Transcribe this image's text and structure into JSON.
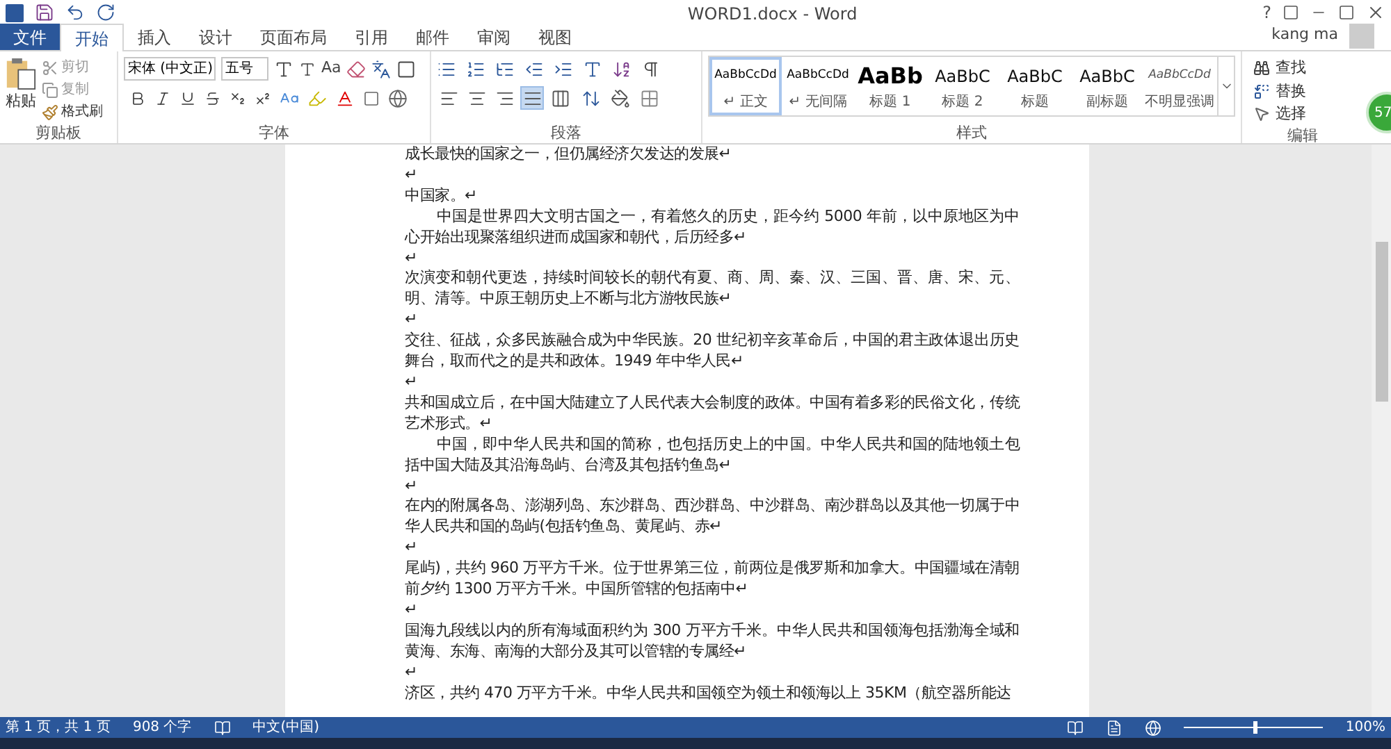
{
  "title_bar": {
    "title": "WORD1.docx - Word",
    "help": "?"
  },
  "tabs": [
    {
      "label": "文件",
      "kind": "file",
      "selected": false
    },
    {
      "label": "开始",
      "kind": "tab",
      "selected": true
    },
    {
      "label": "插入",
      "kind": "tab",
      "selected": false
    },
    {
      "label": "设计",
      "kind": "tab",
      "selected": false
    },
    {
      "label": "页面布局",
      "kind": "tab",
      "selected": false
    },
    {
      "label": "引用",
      "kind": "tab",
      "selected": false
    },
    {
      "label": "邮件",
      "kind": "tab",
      "selected": false
    },
    {
      "label": "审阅",
      "kind": "tab",
      "selected": false
    },
    {
      "label": "视图",
      "kind": "tab",
      "selected": false
    }
  ],
  "account": {
    "name": "kang ma"
  },
  "clipboard": {
    "paste": "粘贴",
    "cut": "剪切",
    "copy": "复制",
    "format_painter": "格式刷",
    "label": "剪贴板"
  },
  "font": {
    "name": "宋体 (中文正)",
    "size": "五号",
    "change_case": "Aa",
    "label": "字体"
  },
  "paragraph": {
    "label": "段落",
    "alignments": [
      {
        "kind": "left",
        "selected": false
      },
      {
        "kind": "center",
        "selected": false
      },
      {
        "kind": "right",
        "selected": false
      },
      {
        "kind": "justify",
        "selected": true
      },
      {
        "kind": "distributed",
        "selected": false
      }
    ]
  },
  "styles": {
    "label": "样式",
    "items": [
      {
        "kind": "normal",
        "preview": "AaBbCcDd",
        "name": "↵ 正文",
        "selected": true
      },
      {
        "kind": "normal",
        "preview": "AaBbCcDd",
        "name": "↵ 无间隔",
        "selected": false
      },
      {
        "kind": "heading1",
        "preview": "AaBb",
        "name": "标题 1",
        "selected": false
      },
      {
        "kind": "heading2",
        "preview": "AaBbC",
        "name": "标题 2",
        "selected": false
      },
      {
        "kind": "heading2",
        "preview": "AaBbC",
        "name": "标题",
        "selected": false
      },
      {
        "kind": "heading2",
        "preview": "AaBbC",
        "name": "副标题",
        "selected": false
      },
      {
        "kind": "emphasis",
        "preview": "AaBbCcDd",
        "name": "不明显强调",
        "selected": false
      }
    ]
  },
  "editing": {
    "find": "查找",
    "replace": "替换",
    "select": "选择",
    "label": "编辑"
  },
  "document": {
    "paragraphs": [
      {
        "text": "成长最快的国家之一，但仍属经济欠发达的发展↵",
        "indent": false
      },
      {
        "text": "↵",
        "indent": false
      },
      {
        "text": "中国家。↵",
        "indent": false
      },
      {
        "text": "中国是世界四大文明古国之一，有着悠久的历史，距今约 5000 年前，以中原地区为中心开始出现聚落组织进而成国家和朝代，后历经多↵",
        "indent": true
      },
      {
        "text": "↵",
        "indent": false
      },
      {
        "text": "次演变和朝代更迭，持续时间较长的朝代有夏、商、周、秦、汉、三国、晋、唐、宋、元、明、清等。中原王朝历史上不断与北方游牧民族↵",
        "indent": false
      },
      {
        "text": "↵",
        "indent": false
      },
      {
        "text": "交往、征战，众多民族融合成为中华民族。20 世纪初辛亥革命后，中国的君主政体退出历史舞台，取而代之的是共和政体。1949 年中华人民↵",
        "indent": false
      },
      {
        "text": "↵",
        "indent": false
      },
      {
        "text": "共和国成立后，在中国大陆建立了人民代表大会制度的政体。中国有着多彩的民俗文化，传统艺术形式。↵",
        "indent": false
      },
      {
        "text": "中国，即中华人民共和国的简称，也包括历史上的中国。中华人民共和国的陆地领土包括中国大陆及其沿海岛屿、台湾及其包括钓鱼岛↵",
        "indent": true
      },
      {
        "text": "↵",
        "indent": false
      },
      {
        "text": "在内的附属各岛、澎湖列岛、东沙群岛、西沙群岛、中沙群岛、南沙群岛以及其他一切属于中华人民共和国的岛屿(包括钓鱼岛、黄尾屿、赤↵",
        "indent": false
      },
      {
        "text": "↵",
        "indent": false
      },
      {
        "text": "尾屿)，共约 960 万平方千米。位于世界第三位，前两位是俄罗斯和加拿大。中国疆域在清朝前夕约 1300 万平方千米。中国所管辖的包括南中↵",
        "indent": false
      },
      {
        "text": "↵",
        "indent": false
      },
      {
        "text": "国海九段线以内的所有海域面积约为  300 万平方千米。中华人民共和国领海包括渤海全域和黄海、东海、南海的大部分及其可以管辖的专属经↵",
        "indent": false
      },
      {
        "text": "↵",
        "indent": false
      },
      {
        "text": "济区，共约 470 万平方千米。中华人民共和国领空为领土和领海以上 35KM（航空器所能达",
        "indent": false
      }
    ]
  },
  "status_bar": {
    "page": "第 1 页，共 1 页",
    "words": "908 个字",
    "language": "中文(中国)",
    "zoom": "100%",
    "zoom_slider": {
      "level": 0.5
    }
  },
  "badge": "57"
}
